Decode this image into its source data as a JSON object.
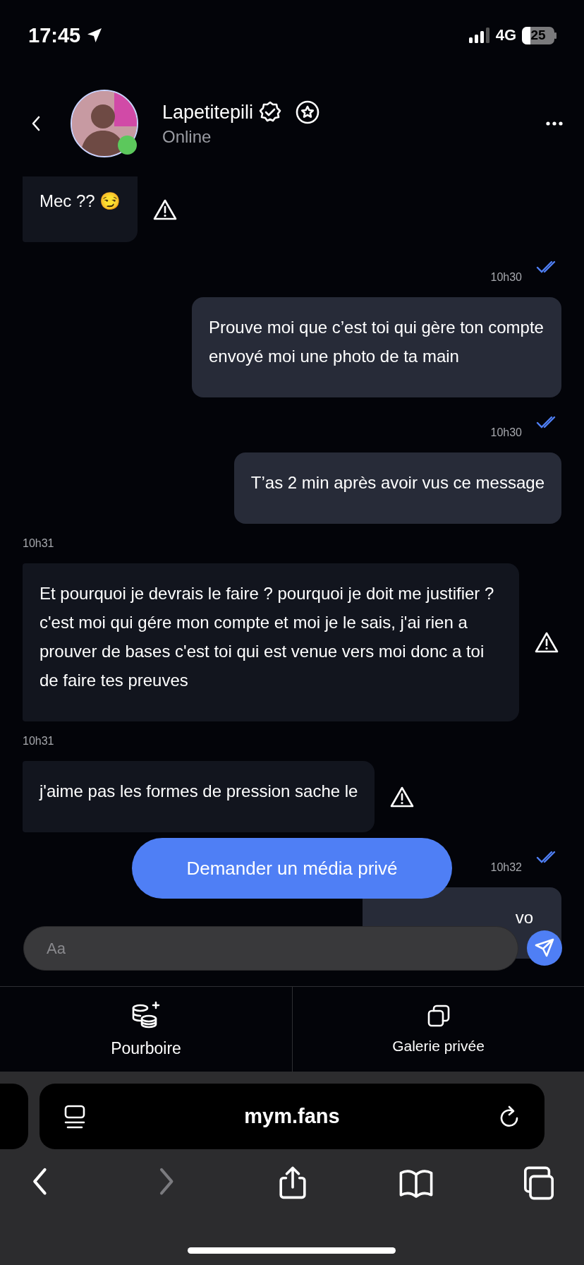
{
  "status_bar": {
    "time": "17:45",
    "network": "4G",
    "battery": "25"
  },
  "header": {
    "name": "Lapetitepili",
    "status": "Online",
    "online": true,
    "verified": true
  },
  "messages": [
    {
      "kind": "bubble",
      "outgoing": false,
      "text": "Mec ?? 😏",
      "flagged": true
    },
    {
      "kind": "time",
      "outgoing": true,
      "text": "10h30",
      "read": true
    },
    {
      "kind": "bubble",
      "outgoing": true,
      "text": "Prouve moi que c’est toi qui gère ton compte envoyé moi une photo de ta main",
      "flagged": false
    },
    {
      "kind": "time",
      "outgoing": true,
      "text": "10h30",
      "read": true
    },
    {
      "kind": "bubble",
      "outgoing": true,
      "text": "T’as 2 min après avoir vus ce message",
      "flagged": false
    },
    {
      "kind": "time",
      "outgoing": false,
      "text": "10h31",
      "read": false
    },
    {
      "kind": "bubble",
      "outgoing": false,
      "text": "Et pourquoi je devrais le faire ? pourquoi je doit me justifier ? c'est moi qui gére mon compte et moi je le sais, j'ai rien a prouver de bases c'est toi qui est venue vers moi donc a toi de faire tes preuves",
      "flagged": true
    },
    {
      "kind": "time",
      "outgoing": false,
      "text": "10h31",
      "read": false
    },
    {
      "kind": "bubble",
      "outgoing": false,
      "text": "j'aime pas les formes de pression sache le",
      "flagged": true
    },
    {
      "kind": "time",
      "outgoing": true,
      "text": "10h32",
      "read": true
    },
    {
      "kind": "bubble",
      "outgoing": true,
      "text": "vo",
      "flagged": false
    }
  ],
  "request_button": "Demander un média privé",
  "composer": {
    "placeholder": "Aa"
  },
  "actions": [
    {
      "kind": "tip",
      "label": "Pourboire"
    },
    {
      "kind": "gallery",
      "label": "Galerie privée"
    }
  ],
  "browser": {
    "url": "mym.fans",
    "nav": [
      {
        "kind": "back",
        "disabled": false
      },
      {
        "kind": "forward",
        "disabled": true
      },
      {
        "kind": "share",
        "disabled": false
      },
      {
        "kind": "bookmarks",
        "disabled": false
      },
      {
        "kind": "tabs",
        "disabled": false
      }
    ]
  }
}
